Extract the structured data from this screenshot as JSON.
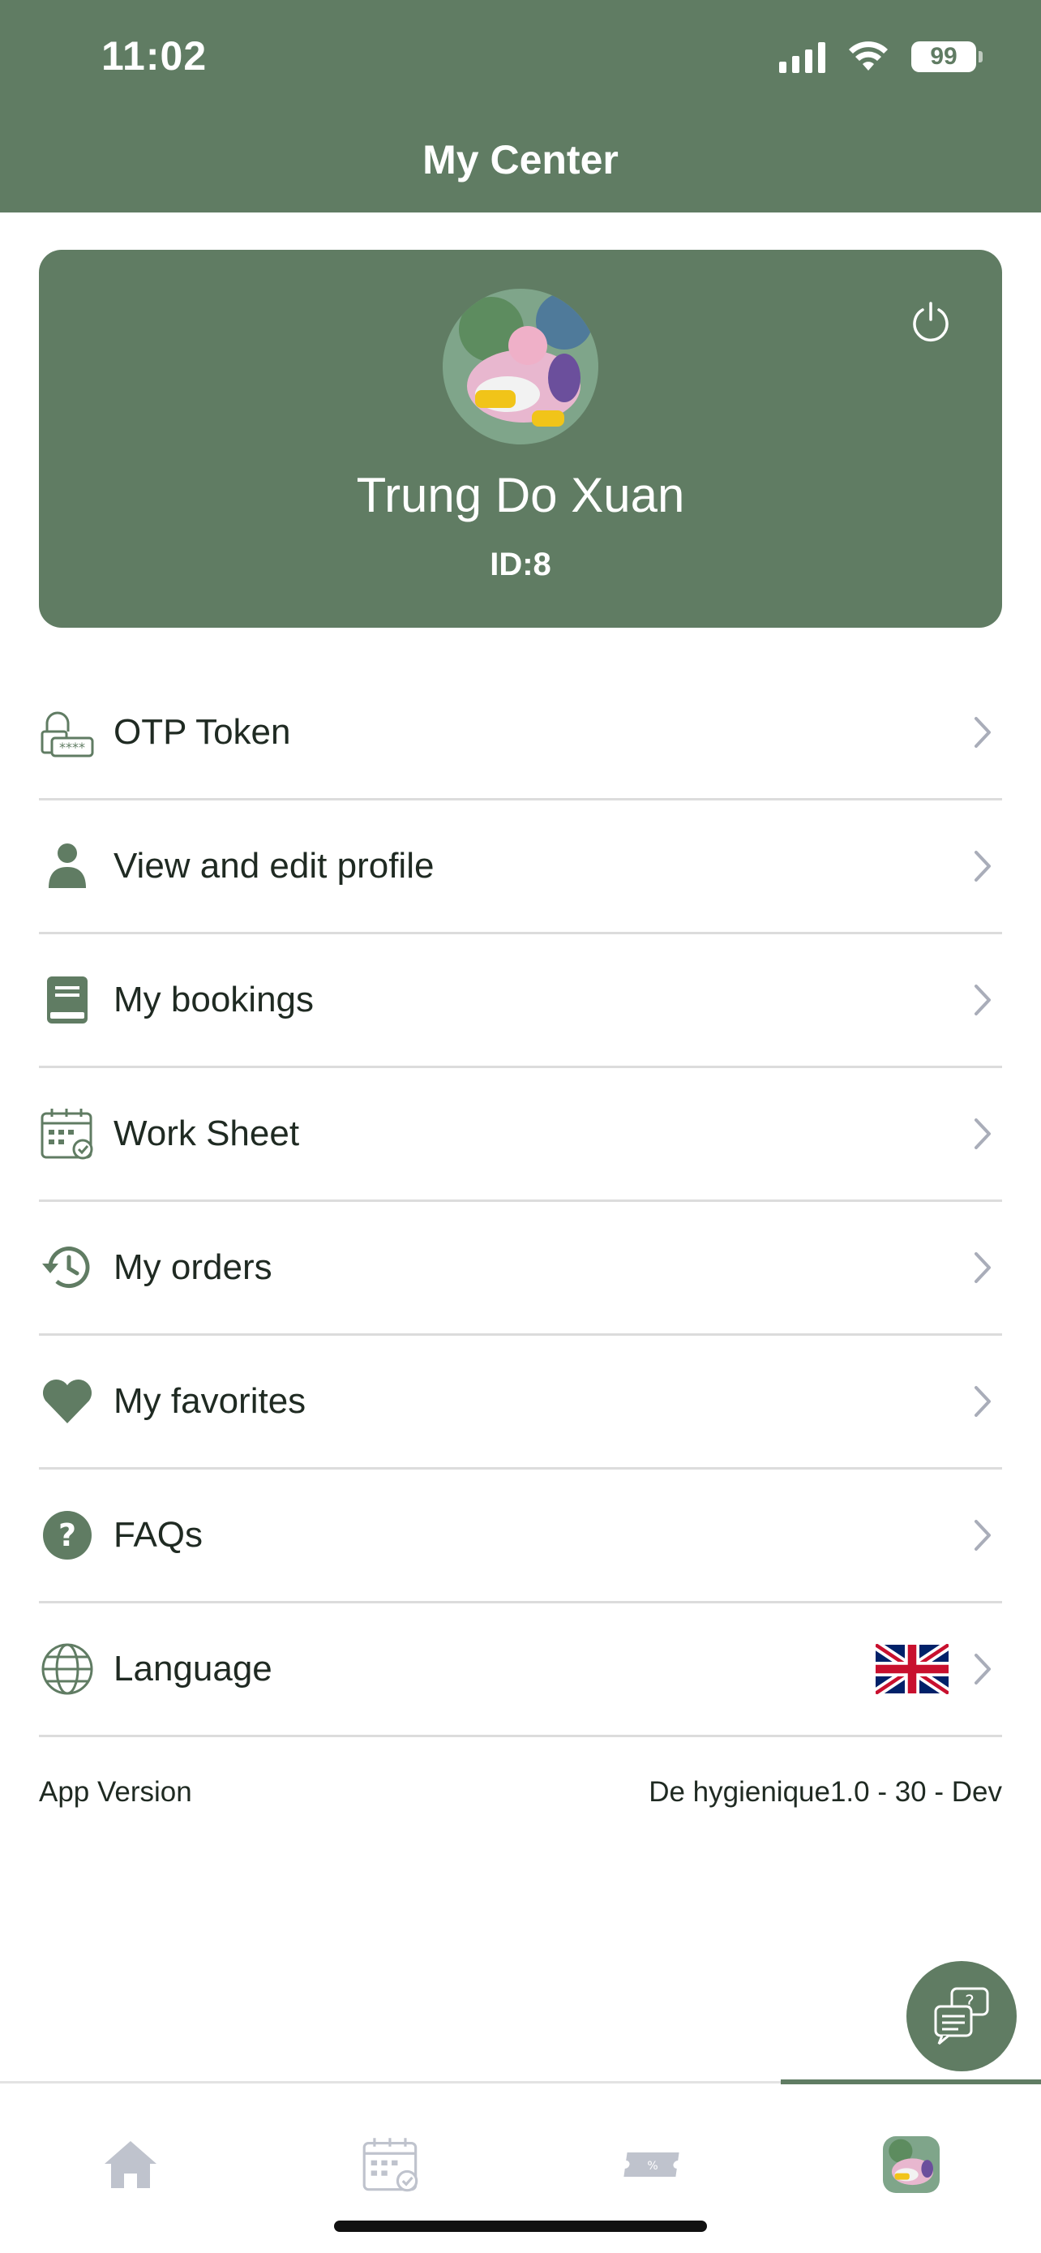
{
  "status_bar": {
    "time": "11:02",
    "battery": "99"
  },
  "header": {
    "title": "My Center"
  },
  "profile": {
    "name": "Trung Do Xuan",
    "id": "ID:8"
  },
  "menu": {
    "items": [
      {
        "label": "OTP Token",
        "icon": "otp-lock-icon"
      },
      {
        "label": "View and edit profile",
        "icon": "person-icon"
      },
      {
        "label": "My bookings",
        "icon": "book-icon"
      },
      {
        "label": "Work Sheet",
        "icon": "calendar-check-icon"
      },
      {
        "label": "My orders",
        "icon": "history-icon"
      },
      {
        "label": "My favorites",
        "icon": "heart-icon"
      },
      {
        "label": "FAQs",
        "icon": "question-icon"
      },
      {
        "label": "Language",
        "icon": "globe-icon"
      }
    ]
  },
  "app_version": {
    "label": "App Version",
    "value": "De hygienique1.0 - 30 - Dev"
  },
  "tabbar": {
    "tabs": [
      "home-icon",
      "calendar-icon",
      "coupon-icon",
      "avatar-tab"
    ],
    "active_index": 3
  },
  "colors": {
    "primary": "#607c63",
    "divider": "#dcdcdc",
    "chevron": "#a9adb9",
    "tab_inactive": "#bfc3cd"
  }
}
